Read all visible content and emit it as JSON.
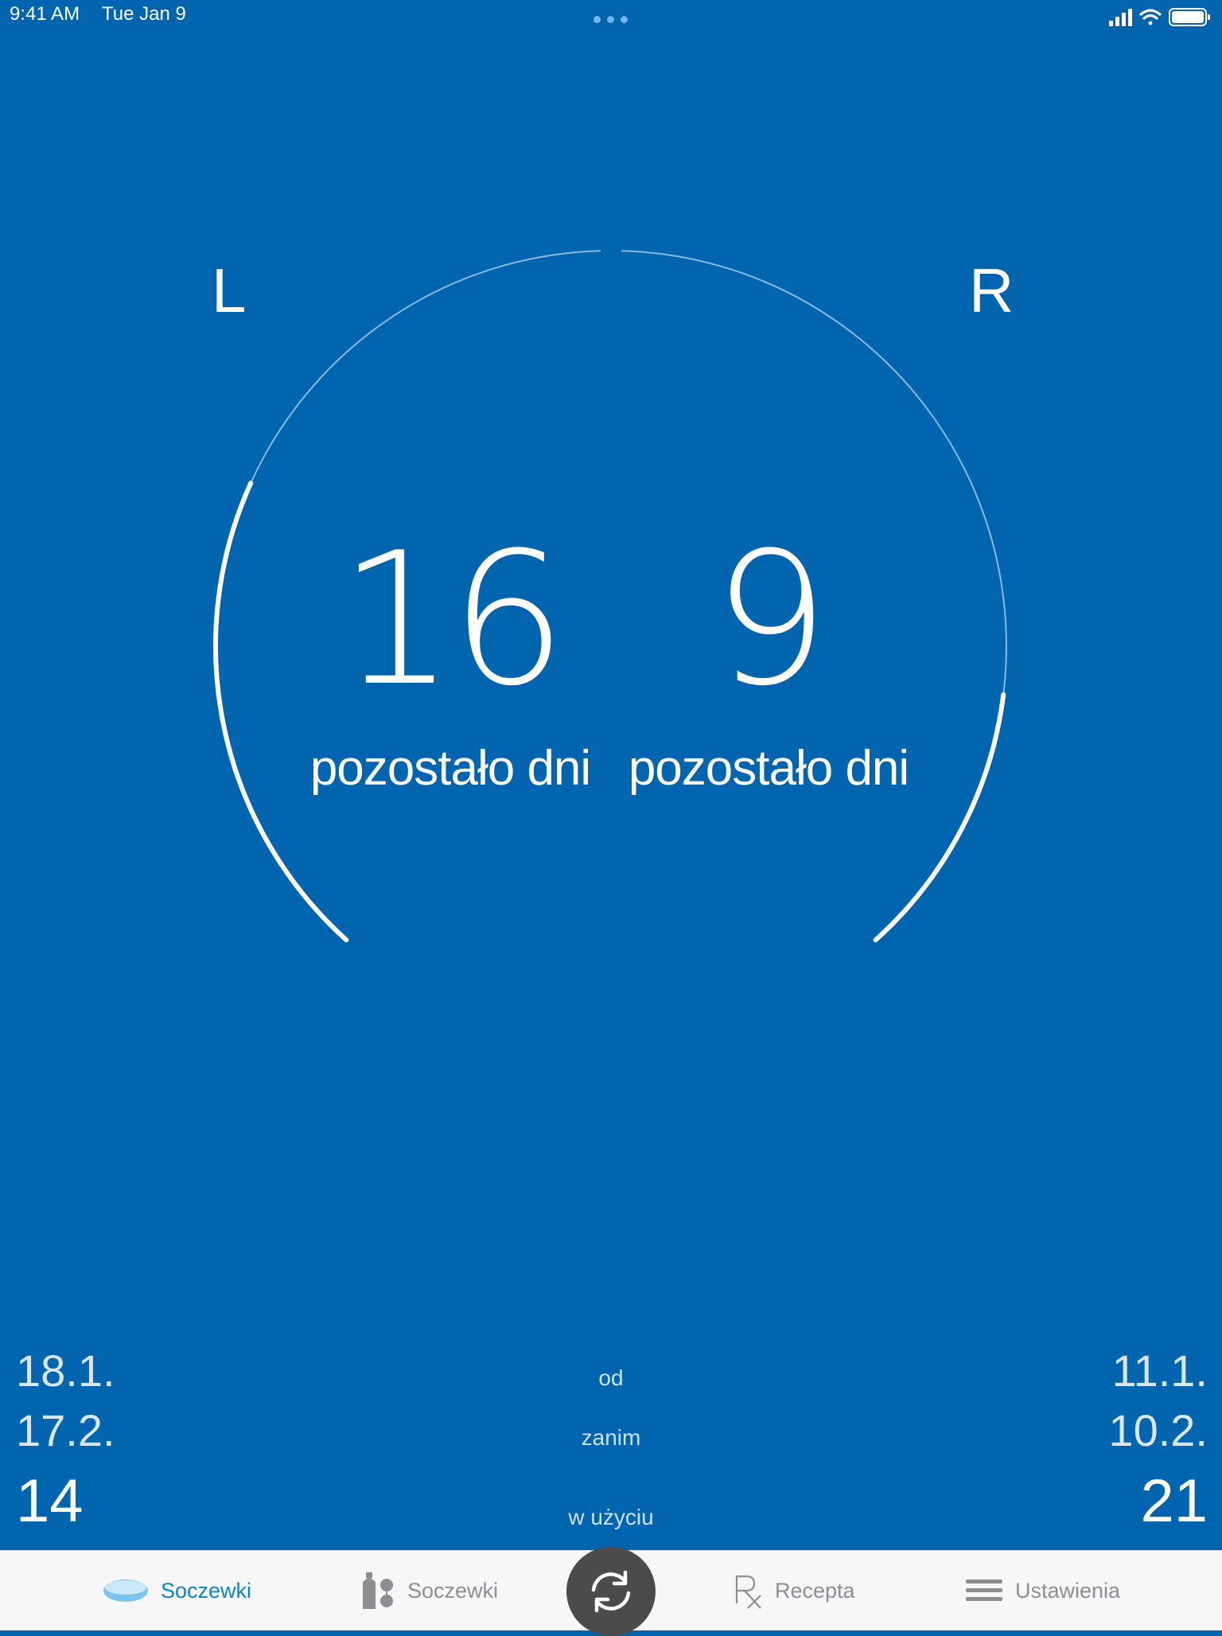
{
  "status": {
    "time": "9:41 AM",
    "date": "Tue Jan 9",
    "icons": [
      "cellular-signal-icon",
      "wifi-icon",
      "battery-icon"
    ]
  },
  "eyes": {
    "left": {
      "label": "L",
      "days_remaining": "16",
      "caption": "pozostało dni",
      "start_date": "18.1.",
      "replace_date": "17.2.",
      "days_in_use": "14",
      "remaining_fraction": 0.53
    },
    "right": {
      "label": "R",
      "days_remaining": "9",
      "caption": "pozostało dni",
      "start_date": "11.1.",
      "replace_date": "10.2.",
      "days_in_use": "21",
      "remaining_fraction": 0.3
    }
  },
  "labels": {
    "from": "od",
    "until": "zanim",
    "in_use": "w użyciu"
  },
  "tabbar": {
    "lenses": "Soczewki",
    "solutions": "Soczewki",
    "prescription": "Recepta",
    "settings": "Ustawienia"
  },
  "colors": {
    "background": "#0064AF",
    "tab_active": "#0a85c9",
    "tab_inactive": "#8e8e93",
    "center_button": "#4b4b4b"
  }
}
